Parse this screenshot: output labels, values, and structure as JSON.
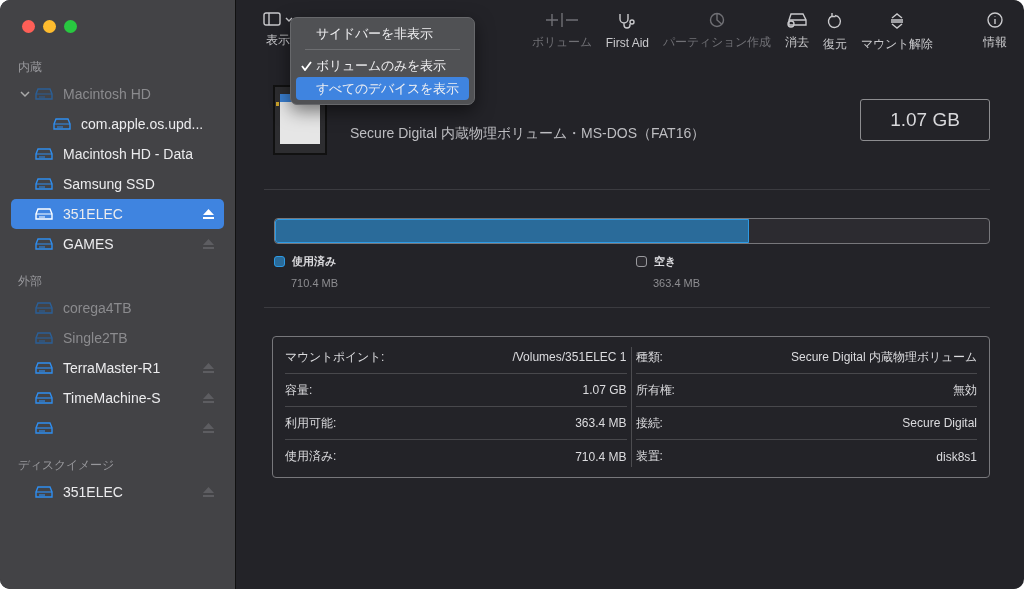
{
  "sidebar": {
    "sections": [
      {
        "title": "内蔵",
        "items": [
          {
            "name": "Macintosh HD",
            "disabled": true,
            "selected": false,
            "eject": false,
            "expanded": true,
            "children": [
              {
                "name": "com.apple.os.upd...",
                "disabled": false,
                "selected": false,
                "eject": false
              }
            ]
          },
          {
            "name": "Macintosh HD - Data",
            "disabled": false,
            "selected": false,
            "eject": false
          },
          {
            "name": "Samsung SSD",
            "disabled": false,
            "selected": false,
            "eject": false
          },
          {
            "name": "351ELEC",
            "disabled": false,
            "selected": true,
            "eject": true
          },
          {
            "name": "GAMES",
            "disabled": false,
            "selected": false,
            "eject": true
          }
        ]
      },
      {
        "title": "外部",
        "items": [
          {
            "name": "corega4TB",
            "disabled": true,
            "selected": false,
            "eject": false
          },
          {
            "name": "Single2TB",
            "disabled": true,
            "selected": false,
            "eject": false
          },
          {
            "name": "TerraMaster-R1",
            "disabled": false,
            "selected": false,
            "eject": true
          },
          {
            "name": "TimeMachine-S",
            "disabled": false,
            "selected": false,
            "eject": true
          },
          {
            "disabled": false,
            "selected": false,
            "eject": true
          }
        ]
      },
      {
        "title": "ディスクイメージ",
        "items": [
          {
            "name": "351ELEC",
            "disabled": false,
            "selected": false,
            "eject": true
          }
        ]
      }
    ]
  },
  "toolbar": {
    "view": {
      "label": "表示"
    },
    "items": [
      {
        "kind": "volume",
        "label": "ボリューム",
        "disabled": true
      },
      {
        "kind": "firstaid",
        "label": "First Aid",
        "disabled": false
      },
      {
        "kind": "partition",
        "label": "パーティション作成",
        "disabled": true
      },
      {
        "kind": "erase",
        "label": "消去",
        "disabled": false
      },
      {
        "kind": "restore",
        "label": "復元",
        "disabled": false
      },
      {
        "kind": "unmount",
        "label": "マウント解除",
        "disabled": false
      },
      {
        "kind": "info",
        "label": "情報",
        "disabled": false
      }
    ]
  },
  "menu": {
    "items": [
      {
        "kind": "item",
        "label": "サイドバーを非表示",
        "checked": false,
        "selected": false
      },
      {
        "kind": "separator"
      },
      {
        "kind": "item",
        "label": "ボリュームのみを表示",
        "checked": true,
        "selected": false
      },
      {
        "kind": "item",
        "label": "すべてのデバイスを表示",
        "checked": false,
        "selected": true
      }
    ]
  },
  "volume": {
    "subtitle": "Secure Digital 内蔵物理ボリューム・MS-DOS（FAT16）",
    "size": "1.07 GB",
    "usage": {
      "level": 0.664,
      "legend": [
        {
          "label": "使用済み",
          "value": "710.4 MB",
          "color": "#2a6b9a"
        },
        {
          "label": "空き",
          "value": "363.4 MB",
          "color": "#2c2b30"
        }
      ]
    },
    "info": {
      "left": [
        {
          "label": "マウントポイント:",
          "value": "/Volumes/351ELEC 1"
        },
        {
          "label": "容量:",
          "value": "1.07 GB"
        },
        {
          "label": "利用可能:",
          "value": "363.4 MB"
        },
        {
          "label": "使用済み:",
          "value": "710.4 MB"
        }
      ],
      "right": [
        {
          "label": "種類:",
          "value": "Secure Digital 内蔵物理ボリューム"
        },
        {
          "label": "所有権:",
          "value": "無効"
        },
        {
          "label": "接続:",
          "value": "Secure Digital"
        },
        {
          "label": "装置:",
          "value": "disk8s1"
        }
      ]
    }
  }
}
